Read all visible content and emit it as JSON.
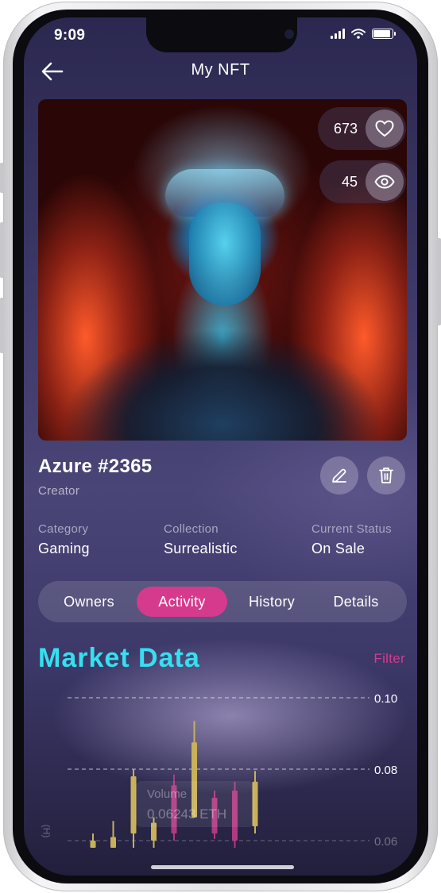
{
  "status_bar": {
    "time": "9:09"
  },
  "header": {
    "title": "My NFT"
  },
  "stats": {
    "likes": "673",
    "views": "45"
  },
  "nft": {
    "name": "Azure #2365",
    "creator_label": "Creator"
  },
  "meta": [
    {
      "label": "Category",
      "value": "Gaming"
    },
    {
      "label": "Collection",
      "value": "Surrealistic"
    },
    {
      "label": "Current Status",
      "value": "On Sale"
    }
  ],
  "tabs": [
    "Owners",
    "Activity",
    "History",
    "Details"
  ],
  "active_tab": "Activity",
  "market": {
    "title": "Market Data",
    "filter_label": "Filter"
  },
  "chart_data": {
    "type": "bar",
    "y_ticks": [
      "0.10",
      "0.08",
      "0.06"
    ],
    "ylim": [
      0.06,
      0.1
    ],
    "tooltip": {
      "label": "Volume",
      "value": "0.06243 ETH"
    },
    "y_axis_label_partial": "(H)",
    "candles": [
      {
        "color": "#c9b05a",
        "low": 0.058,
        "high": 0.062,
        "open": 0.058,
        "close": 0.06
      },
      {
        "color": "#c9b05a",
        "low": 0.058,
        "high": 0.0655,
        "open": 0.058,
        "close": 0.061
      },
      {
        "color": "#c9b05a",
        "low": 0.058,
        "high": 0.08,
        "open": 0.062,
        "close": 0.078
      },
      {
        "color": "#c9b05a",
        "low": 0.058,
        "high": 0.0665,
        "open": 0.06,
        "close": 0.065
      },
      {
        "color": "#b03a82",
        "low": 0.06,
        "high": 0.0785,
        "open": 0.062,
        "close": 0.0755
      },
      {
        "color": "#c9b05a",
        "low": 0.0665,
        "high": 0.0935,
        "open": 0.0665,
        "close": 0.0875
      },
      {
        "color": "#b03a82",
        "low": 0.0605,
        "high": 0.074,
        "open": 0.062,
        "close": 0.072
      },
      {
        "color": "#b03a82",
        "low": 0.058,
        "high": 0.0765,
        "open": 0.06,
        "close": 0.074
      },
      {
        "color": "#c9b05a",
        "low": 0.062,
        "high": 0.0795,
        "open": 0.064,
        "close": 0.0765
      }
    ]
  },
  "colors": {
    "accent": "#d63a8c",
    "title_cyan": "#35e0f0"
  }
}
